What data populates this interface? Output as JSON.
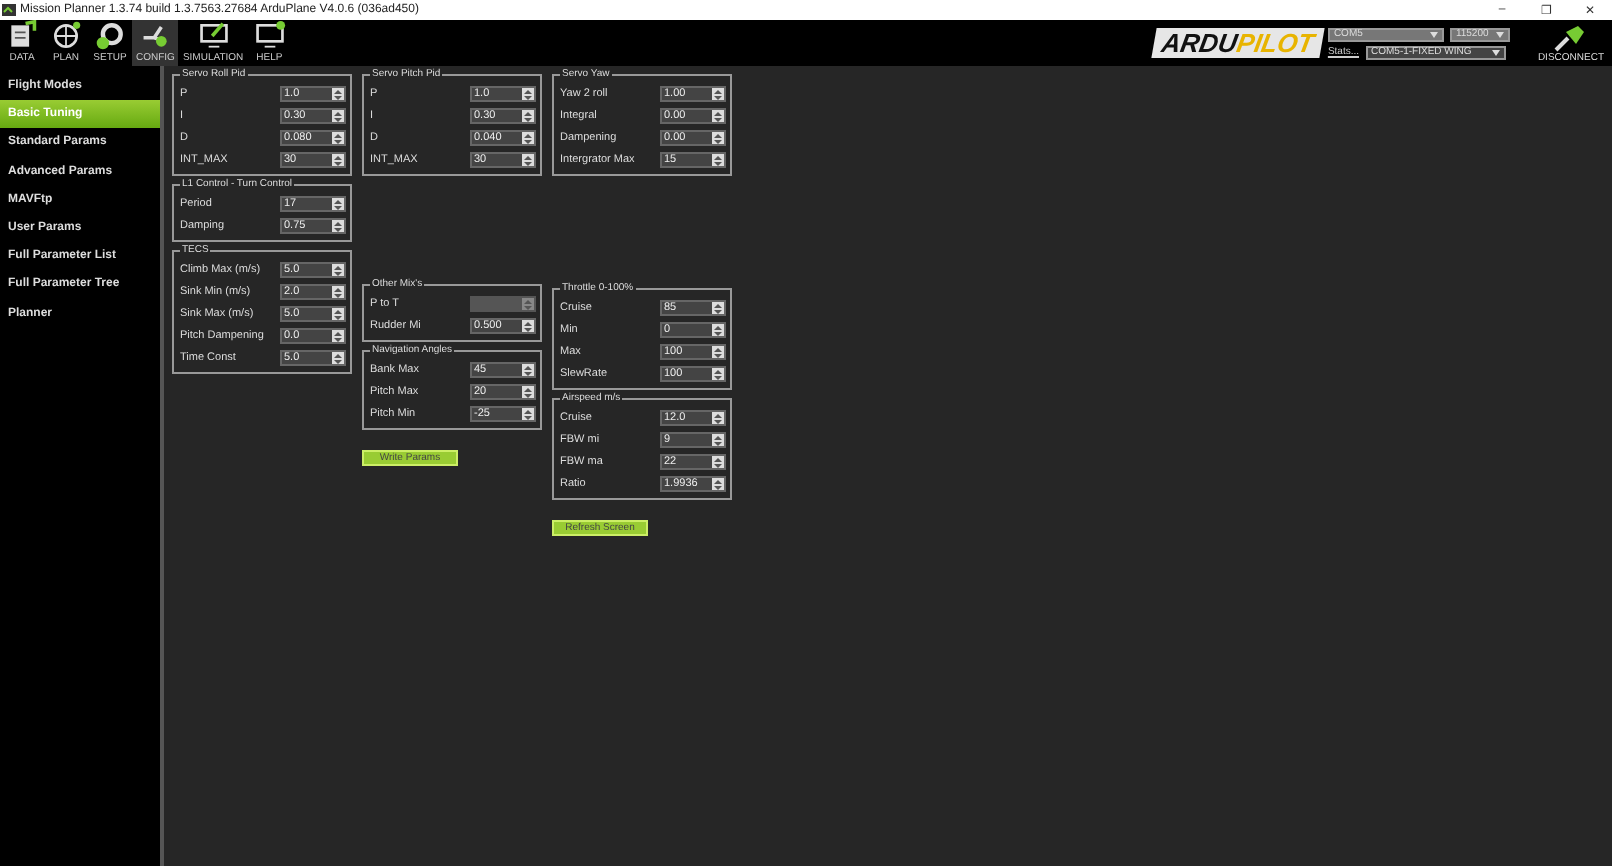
{
  "window": {
    "title": "Mission Planner 1.3.74 build 1.3.7563.27684 ArduPlane V4.0.6 (036ad450)",
    "controls": [
      "–",
      "❐",
      "✕"
    ]
  },
  "toolbar": [
    {
      "label": "DATA",
      "selected": false
    },
    {
      "label": "PLAN",
      "selected": false
    },
    {
      "label": "SETUP",
      "selected": false
    },
    {
      "label": "CONFIG",
      "selected": true
    },
    {
      "label": "SIMULATION",
      "selected": false
    },
    {
      "label": "HELP",
      "selected": false
    }
  ],
  "logo": {
    "part_1": "ARDU",
    "part_2": "PILOT"
  },
  "connection": {
    "port": "COM5",
    "baud": "115200",
    "stats": "Stats...",
    "vehicle": "COM5-1-FIXED WING",
    "disconnect": "DISCONNECT"
  },
  "sidebar": {
    "items": [
      {
        "label": "Flight Modes",
        "selected": false
      },
      {
        "label": "Basic Tuning",
        "selected": true
      },
      {
        "label": "Standard Params",
        "selected": false
      },
      {
        "label": "Advanced Params",
        "selected": false
      },
      {
        "label": "MAVFtp",
        "selected": false
      },
      {
        "label": "User Params",
        "selected": false
      },
      {
        "label": "Full Parameter List",
        "selected": false
      },
      {
        "label": "Full Parameter Tree",
        "selected": false
      },
      {
        "label": "Planner",
        "selected": false
      }
    ]
  },
  "columns": [
    {
      "groups": [
        {
          "title": "Servo Roll Pid",
          "fields": [
            {
              "label": "P",
              "value": "1.0",
              "disabled": false
            },
            {
              "label": "I",
              "value": "0.30",
              "disabled": false
            },
            {
              "label": "D",
              "value": "0.080",
              "disabled": false
            },
            {
              "label": "INT_MAX",
              "value": "30",
              "disabled": false
            }
          ]
        },
        {
          "title": "L1 Control - Turn Control",
          "fields": [
            {
              "label": "Period",
              "value": "17",
              "disabled": false
            },
            {
              "label": "Damping",
              "value": "0.75",
              "disabled": false
            }
          ]
        },
        {
          "title": "TECS",
          "fields": [
            {
              "label": "Climb Max (m/s)",
              "value": "5.0",
              "disabled": false
            },
            {
              "label": "Sink Min (m/s)",
              "value": "2.0",
              "disabled": false
            },
            {
              "label": "Sink Max (m/s)",
              "value": "5.0",
              "disabled": false
            },
            {
              "label": "Pitch Dampening",
              "value": "0.0",
              "disabled": false
            },
            {
              "label": "Time Const",
              "value": "5.0",
              "disabled": false
            }
          ]
        }
      ]
    },
    {
      "groups": [
        {
          "title": "Servo Pitch Pid",
          "fields": [
            {
              "label": "P",
              "value": "1.0",
              "disabled": false
            },
            {
              "label": "I",
              "value": "0.30",
              "disabled": false
            },
            {
              "label": "D",
              "value": "0.040",
              "disabled": false
            },
            {
              "label": "INT_MAX",
              "value": "30",
              "disabled": false
            }
          ]
        },
        {
          "title": "Other Mix's",
          "fields": [
            {
              "label": "P to T",
              "disabled": true
            },
            {
              "label": "Rudder Mi",
              "value": "0.500",
              "disabled": false
            }
          ]
        },
        {
          "title": "Navigation Angles",
          "fields": [
            {
              "label": "Bank Max",
              "value": "45",
              "disabled": false
            },
            {
              "label": "Pitch Max",
              "value": "20",
              "disabled": false
            },
            {
              "label": "Pitch Min",
              "value": "-25",
              "disabled": false
            }
          ]
        }
      ],
      "button": "Write Params"
    },
    {
      "groups": [
        {
          "title": "Servo Yaw",
          "fields": [
            {
              "label": "Yaw 2 roll",
              "value": "1.00",
              "disabled": false
            },
            {
              "label": "Integral",
              "value": "0.00",
              "disabled": false
            },
            {
              "label": "Dampening",
              "value": "0.00",
              "disabled": false
            },
            {
              "label": "Intergrator Max",
              "value": "15",
              "disabled": false
            }
          ]
        },
        {
          "title": "Throttle 0-100%",
          "fields": [
            {
              "label": "Cruise",
              "value": "85",
              "disabled": false
            },
            {
              "label": "Min",
              "value": "0",
              "disabled": false
            },
            {
              "label": "Max",
              "value": "100",
              "disabled": false
            },
            {
              "label": "SlewRate",
              "value": "100",
              "disabled": false
            }
          ]
        },
        {
          "title": "Airspeed m/s",
          "fields": [
            {
              "label": "Cruise",
              "value": "12.0",
              "disabled": false
            },
            {
              "label": "FBW mi",
              "value": "9",
              "disabled": false
            },
            {
              "label": "FBW ma",
              "value": "22",
              "disabled": false
            },
            {
              "label": "Ratio",
              "value": "1.9936",
              "disabled": false
            }
          ]
        }
      ],
      "button": "Refresh Screen"
    }
  ]
}
